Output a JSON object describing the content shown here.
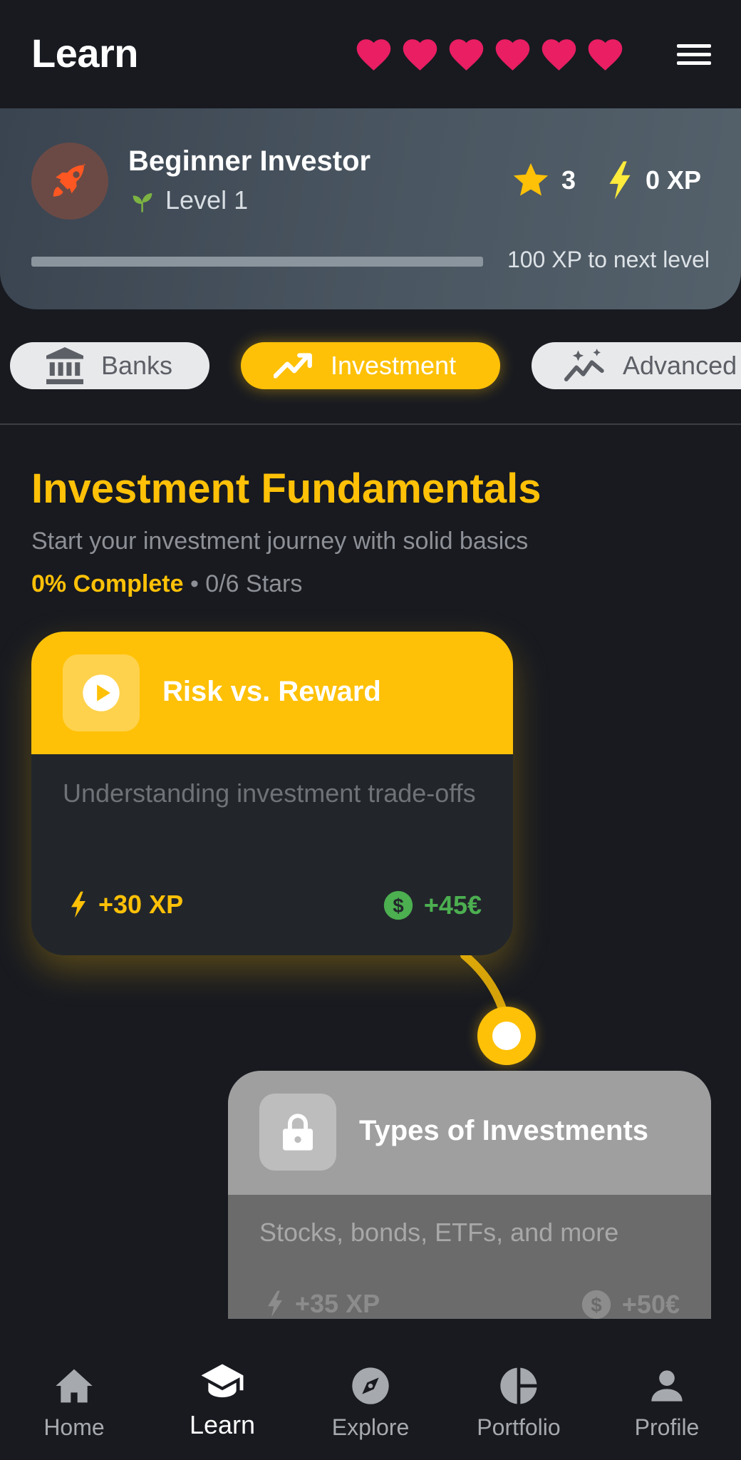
{
  "header": {
    "title": "Learn",
    "hearts": 6,
    "heart_color": "#e91e63"
  },
  "profile": {
    "rank": "Beginner Investor",
    "level": "Level 1",
    "stars": "3",
    "xp": "0 XP",
    "progress_fraction": 0.0,
    "progress_text": "100 XP to next level",
    "accent": "#ffc107"
  },
  "categories": [
    {
      "label": "Banks",
      "icon": "bank-icon",
      "active": false
    },
    {
      "label": "Investment",
      "icon": "trending-up-icon",
      "active": true
    },
    {
      "label": "Advanced",
      "icon": "sparkle-chart-icon",
      "active": false
    }
  ],
  "section": {
    "title": "Investment Fundamentals",
    "subtitle": "Start your investment journey with solid basics",
    "complete": "0% Complete",
    "stars": "• 0/6 Stars"
  },
  "lessons": [
    {
      "title": "Risk vs. Reward",
      "description": "Understanding investment trade-offs",
      "xp": "+30 XP",
      "reward": "+45€",
      "icon": "play-icon",
      "state": "unlocked"
    },
    {
      "title": "Types of Investments",
      "description": "Stocks, bonds, ETFs, and more",
      "xp": "+35 XP",
      "reward": "+50€",
      "icon": "lock-icon",
      "state": "locked"
    }
  ],
  "nav": [
    {
      "label": "Home",
      "icon": "home-icon"
    },
    {
      "label": "Learn",
      "icon": "graduation-cap-icon",
      "active": true
    },
    {
      "label": "Explore",
      "icon": "compass-icon"
    },
    {
      "label": "Portfolio",
      "icon": "pie-chart-icon"
    },
    {
      "label": "Profile",
      "icon": "person-icon"
    }
  ]
}
